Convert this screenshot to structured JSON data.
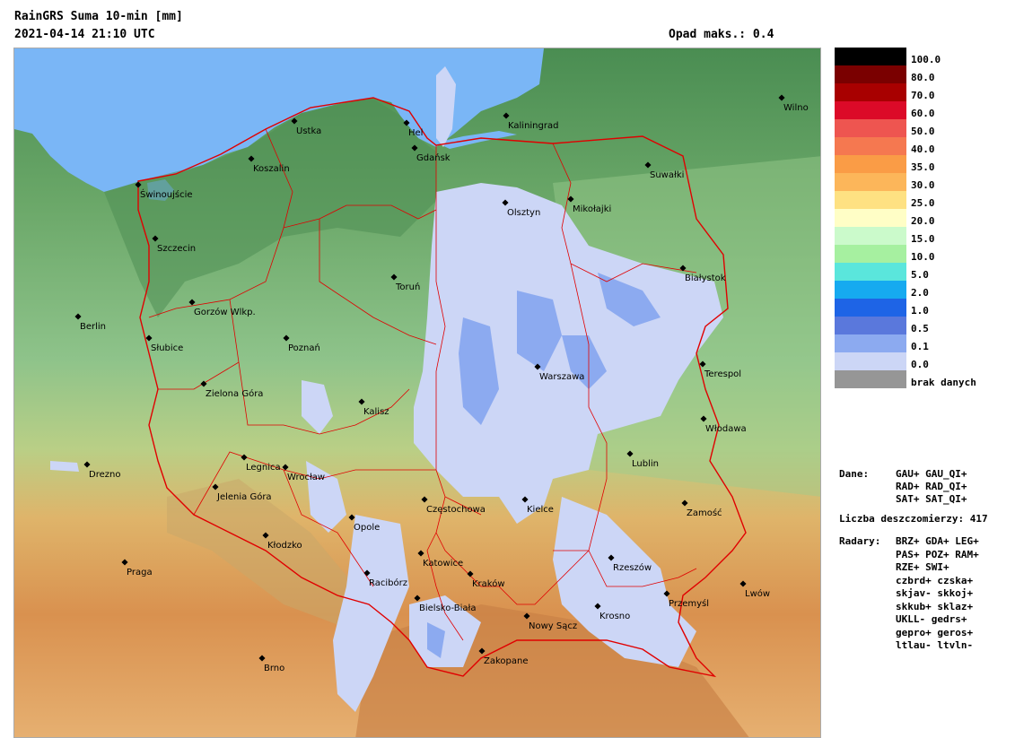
{
  "header": {
    "title": "RainGRS Suma 10-min [mm]",
    "timestamp": "2021-04-14 21:10 UTC",
    "max_precip": "Opad maks.: 0.4"
  },
  "cities": [
    {
      "name": "Ustka",
      "key": "ustka"
    },
    {
      "name": "Hel",
      "key": "hel"
    },
    {
      "name": "Kaliningrad",
      "key": "kaliningrad"
    },
    {
      "name": "Gdańsk",
      "key": "gdansk"
    },
    {
      "name": "Koszalin",
      "key": "koszalin"
    },
    {
      "name": "Świnoujście",
      "key": "swinoujscie"
    },
    {
      "name": "Szczecin",
      "key": "szczecin"
    },
    {
      "name": "Olsztyn",
      "key": "olsztyn"
    },
    {
      "name": "Mikołajki",
      "key": "mikolajki"
    },
    {
      "name": "Suwałki",
      "key": "suwalki"
    },
    {
      "name": "Wilno",
      "key": "wilno"
    },
    {
      "name": "Białystok",
      "key": "bialystok"
    },
    {
      "name": "Toruń",
      "key": "torun"
    },
    {
      "name": "Gorzów Wlkp.",
      "key": "gorzow"
    },
    {
      "name": "Berlin",
      "key": "berlin"
    },
    {
      "name": "Słubice",
      "key": "slubice"
    },
    {
      "name": "Poznań",
      "key": "poznan"
    },
    {
      "name": "Warszawa",
      "key": "warszawa"
    },
    {
      "name": "Terespol",
      "key": "terespol"
    },
    {
      "name": "Zielona Góra",
      "key": "zielonagora"
    },
    {
      "name": "Kalisz",
      "key": "kalisz"
    },
    {
      "name": "Włodawa",
      "key": "wlodawa"
    },
    {
      "name": "Lublin",
      "key": "lublin"
    },
    {
      "name": "Drezno",
      "key": "drezno"
    },
    {
      "name": "Legnica",
      "key": "legnica"
    },
    {
      "name": "Wrocław",
      "key": "wroclaw"
    },
    {
      "name": "Jelenia Góra",
      "key": "jeleniagora"
    },
    {
      "name": "Częstochowa",
      "key": "czestochowa"
    },
    {
      "name": "Kielce",
      "key": "kielce"
    },
    {
      "name": "Zamość",
      "key": "zamosc"
    },
    {
      "name": "Opole",
      "key": "opole"
    },
    {
      "name": "Kłodzko",
      "key": "klodzko"
    },
    {
      "name": "Praga",
      "key": "praga"
    },
    {
      "name": "Katowice",
      "key": "katowice"
    },
    {
      "name": "Rzeszów",
      "key": "rzeszow"
    },
    {
      "name": "Kraków",
      "key": "krakow"
    },
    {
      "name": "Racibórz",
      "key": "raciborz"
    },
    {
      "name": "Lwów",
      "key": "lwow"
    },
    {
      "name": "Przemyśl",
      "key": "przemysl"
    },
    {
      "name": "Bielsko-Biała",
      "key": "bielsko"
    },
    {
      "name": "Nowy Sącz",
      "key": "nowysacz"
    },
    {
      "name": "Krosno",
      "key": "krosno"
    },
    {
      "name": "Zakopane",
      "key": "zakopane"
    },
    {
      "name": "Brno",
      "key": "brno"
    }
  ],
  "legend": [
    {
      "label": "100.0",
      "color": "#000000"
    },
    {
      "label": "80.0",
      "color": "#7a0000"
    },
    {
      "label": "70.0",
      "color": "#a80000"
    },
    {
      "label": "60.0",
      "color": "#dc0a28"
    },
    {
      "label": "50.0",
      "color": "#ee5550"
    },
    {
      "label": "40.0",
      "color": "#f57850"
    },
    {
      "label": "35.0",
      "color": "#fa9c46"
    },
    {
      "label": "30.0",
      "color": "#fcb65a"
    },
    {
      "label": "25.0",
      "color": "#fee182"
    },
    {
      "label": "20.0",
      "color": "#fffec6"
    },
    {
      "label": "15.0",
      "color": "#cbfacb"
    },
    {
      "label": "10.0",
      "color": "#a6f0a0"
    },
    {
      "label": "5.0",
      "color": "#5ae6dc"
    },
    {
      "label": "2.0",
      "color": "#16aaf0"
    },
    {
      "label": "1.0",
      "color": "#1e64e6"
    },
    {
      "label": "0.5",
      "color": "#5a78dc"
    },
    {
      "label": "0.1",
      "color": "#8caaf0"
    },
    {
      "label": "0.0",
      "color": "#ccd6f6"
    },
    {
      "label": "brak danych",
      "color": "#969696"
    }
  ],
  "info": {
    "dane_label": "Dane:",
    "dane_lines": [
      "GAU+ GAU_QI+",
      "RAD+ RAD_QI+",
      "SAT+ SAT_QI+"
    ],
    "liczba": "Liczba deszczomierzy: 417",
    "radary_label": "Radary:",
    "radary_lines": [
      "BRZ+ GDA+ LEG+",
      "PAS+ POZ+ RAM+",
      "RZE+ SWI+",
      "czbrd+ czska+",
      "skjav- skkoj+",
      "skkub+ sklaz+",
      "UKLL- gedrs+",
      "gepro+ geros+",
      "ltlau- ltvln-"
    ]
  },
  "map_colors": {
    "sea": "#7ab6f6",
    "lowland": "#5d9a5c",
    "plain": "#8cc28a",
    "upland": "#c6d089",
    "hills": "#dca55f",
    "mountains": "#c78348",
    "border": "#e00000",
    "rain": "#ccd6f6",
    "rain_medium": "#8caaf0"
  }
}
